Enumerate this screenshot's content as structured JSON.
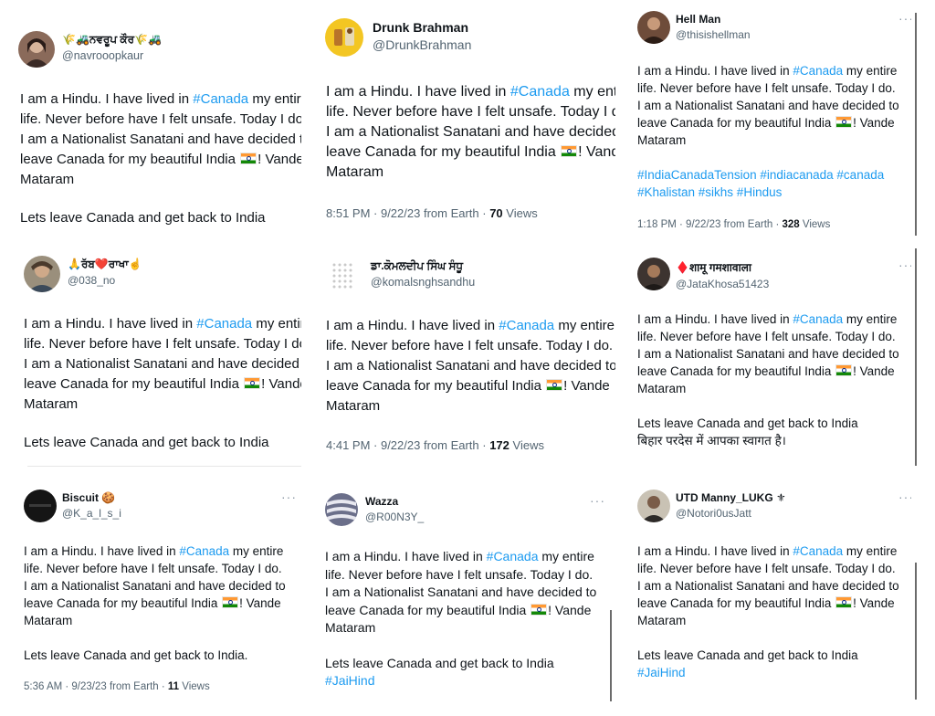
{
  "tweet_body": {
    "p1": "I am a Hindu. I have lived in ",
    "hashtag_canada": "#Canada",
    "p2": " my entire",
    "line2": "life. Never before have I felt unsafe. Today I do.",
    "line3": "I am a Nationalist Sanatani and have decided to",
    "line4a": "leave Canada for my beautiful India ",
    "line4b": "! Vande",
    "line5": "Mataram",
    "leave": "Lets leave Canada and get back to India",
    "leave_period": "Lets leave Canada and get back to India.",
    "bihar": "बिहार परदेस में आपका स्वागत है।",
    "hashtags_hellman_1": "#IndiaCanadaTension #indiacanada #canada",
    "hashtags_hellman_2": "#Khalistan #sikhs #Hindus",
    "jaihind": "#JaiHind"
  },
  "tweets": {
    "navroop": {
      "name": "🌾🚜ਨਵਰੂਪ ਕੌਰ🌾🚜",
      "handle": "@navrooopkaur"
    },
    "drunk": {
      "name": "Drunk Brahman",
      "handle": "@DrunkBrahman",
      "time": "8:51 PM · 9/22/23 from Earth · ",
      "views": "70",
      "views_label": " Views"
    },
    "hellman": {
      "name": "Hell Man",
      "handle": "@thisishellman",
      "time": "1:18 PM · 9/22/23 from Earth · ",
      "views": "328",
      "views_label": " Views"
    },
    "rabb": {
      "name": "🙏ਰੱਬ❤️ਰਾਖਾ☝️",
      "handle": "@038_no"
    },
    "komal": {
      "name": "ਡਾ.ਕੋਮਲਦੀਪ ਸਿੰਘ ਸੰਧੂ",
      "handle": "@komalsnghsandhu",
      "time": "4:41 PM · 9/22/23 from Earth · ",
      "views": "172",
      "views_label": " Views"
    },
    "jata": {
      "name": "♦️शामू गमशावाला",
      "handle": "@JataKhosa51423"
    },
    "biscuit": {
      "name": "Biscuit 🍪",
      "handle": "@K_a_l_s_i",
      "time": "5:36 AM · 9/23/23 from Earth · ",
      "views": "11",
      "views_label": " Views"
    },
    "wazza": {
      "name": "Wazza",
      "handle": "@R00N3Y_"
    },
    "utd": {
      "name": "UTD Manny_LUKG ⚜",
      "handle": "@Notori0usJatt"
    }
  },
  "more_glyph": "···",
  "colors": {
    "hashtag": "#1d9bf0",
    "secondary": "#536471",
    "primary": "#0f1419"
  }
}
